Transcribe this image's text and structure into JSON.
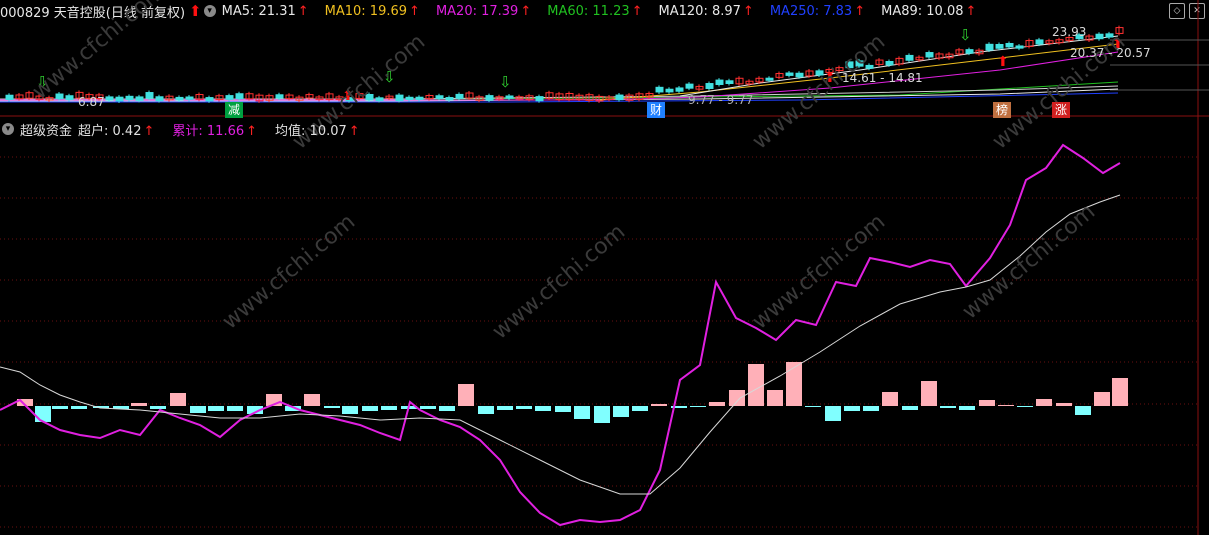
{
  "header": {
    "stock_label": "000829 天音控股(日线 前复权)",
    "ma": [
      {
        "label": "MA5: 21.31",
        "color": "#e8e8e8"
      },
      {
        "label": "MA10: 19.69",
        "color": "#f0c020"
      },
      {
        "label": "MA20: 17.39",
        "color": "#e020e0"
      },
      {
        "label": "MA60: 11.23",
        "color": "#20c020"
      },
      {
        "label": "MA120: 8.97",
        "color": "#e8e8e8"
      },
      {
        "label": "MA250: 7.83",
        "color": "#2040ff"
      },
      {
        "label": "MA89: 10.08",
        "color": "#e8e8e8"
      }
    ],
    "up_arrow": "↑"
  },
  "price_annotations": {
    "high": "23.93",
    "range_a": "20.37 - 20.57",
    "range_b": "14.61 - 14.81",
    "low": "6.87",
    "mid": "9.77 - 9.77"
  },
  "tags": [
    {
      "text": "减",
      "color": "#00a040"
    },
    {
      "text": "财",
      "color": "#2080ff"
    },
    {
      "text": "榜",
      "color": "#c07040"
    },
    {
      "text": "涨",
      "color": "#d02020"
    }
  ],
  "indicator": {
    "name": "超级资金",
    "items": [
      {
        "label": "超户: 0.42",
        "color": "#e0e0e0"
      },
      {
        "label": "累计: 11.66",
        "color": "#e020e0"
      },
      {
        "label": "均值: 10.07",
        "color": "#e0e0e0"
      }
    ]
  },
  "watermark": "www.cfchi.com",
  "colors": {
    "pos_bar": "#ffb0b8",
    "neg_bar": "#80ffff",
    "cum_line": "#e020e0",
    "avg_line": "#d8d8d8",
    "grid": "#6a1010"
  }
}
